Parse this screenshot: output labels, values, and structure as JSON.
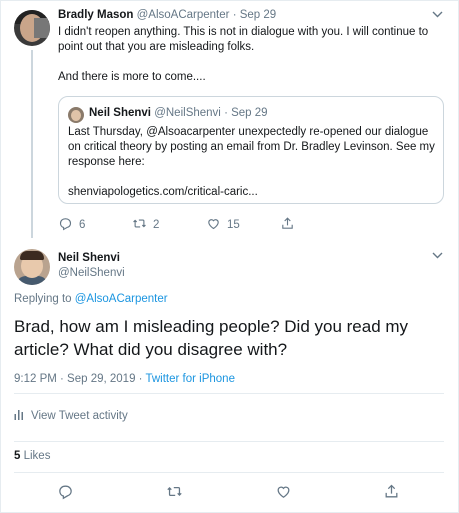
{
  "parent_tweet": {
    "author_name": "Bradly Mason",
    "author_handle": "@AlsoACarpenter",
    "separator": "·",
    "time": "Sep 29",
    "text": "I didn't reopen anything. This is not in dialogue with you. I will continue to point out that you are misleading folks.\n\nAnd there is more to come....",
    "quoted": {
      "author_name": "Neil Shenvi",
      "author_handle": "@NeilShenvi",
      "separator": "·",
      "time": "Sep 29",
      "text": "Last Thursday, @Alsoacarpenter unexpectedly re-opened our dialogue on critical theory by posting an email from Dr. Bradley Levinson. See my response here:\n\nshenviapologetics.com/critical-caric..."
    },
    "actions": {
      "reply_count": "6",
      "retweet_count": "2",
      "like_count": "15"
    }
  },
  "main_tweet": {
    "author_name": "Neil Shenvi",
    "author_handle": "@NeilShenvi",
    "replying_prefix": "Replying to ",
    "replying_to": "@AlsoACarpenter",
    "text": "Brad, how am I misleading people? Did you read my article? What did you disagree with?",
    "timestamp": "9:12 PM · Sep 29, 2019 · ",
    "source": "Twitter for iPhone",
    "activity_label": "View Tweet activity",
    "likes_count": "5",
    "likes_label": " Likes"
  },
  "icons": {
    "reply": "reply-icon",
    "retweet": "retweet-icon",
    "like": "heart-icon",
    "share": "share-icon",
    "caret": "chevron-down-icon",
    "activity": "bar-chart-icon"
  },
  "colors": {
    "link": "#1b95e0",
    "secondary_text": "#657786",
    "border": "#e6ecf0"
  }
}
